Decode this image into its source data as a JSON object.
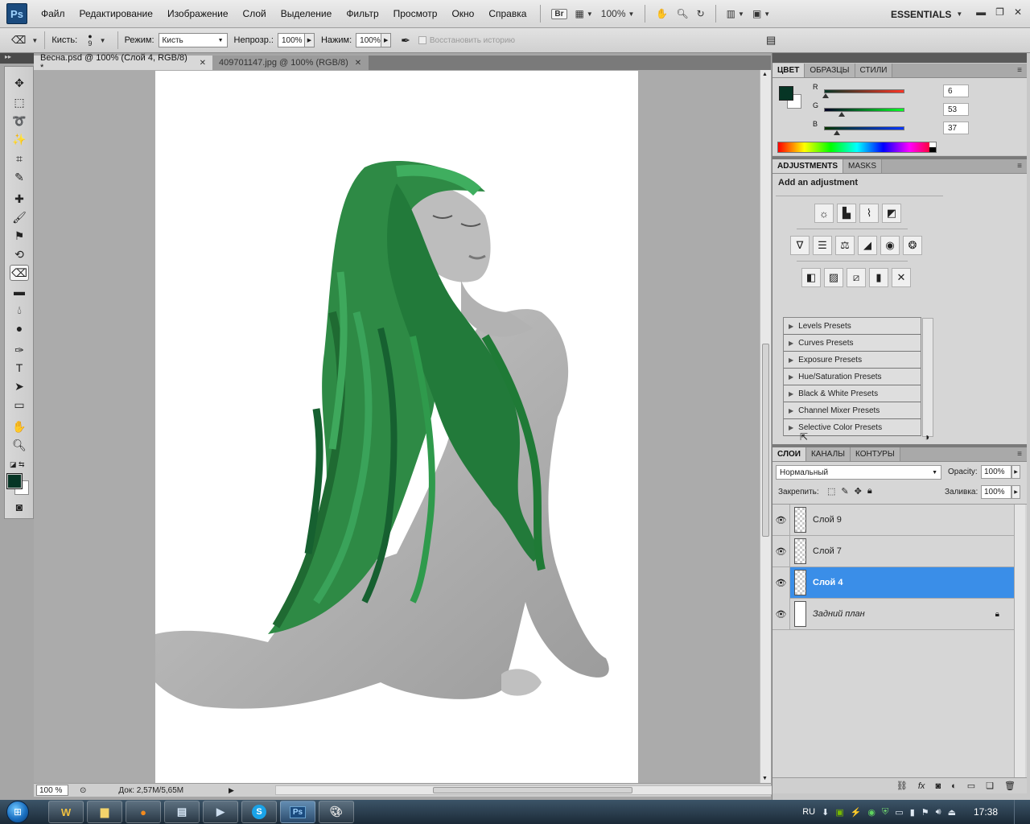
{
  "app": {
    "logo": "Ps",
    "menu": [
      "Файл",
      "Редактирование",
      "Изображение",
      "Слой",
      "Выделение",
      "Фильтр",
      "Просмотр",
      "Окно",
      "Справка"
    ],
    "bridge_label": "Br",
    "zoom": "100%",
    "workspace": "ESSENTIALS"
  },
  "options": {
    "brush_label": "Кисть:",
    "brush_size": "9",
    "mode_label": "Режим:",
    "mode_value": "Кисть",
    "opacity_label": "Непрозр.:",
    "opacity_value": "100%",
    "pressure_label": "Нажим:",
    "pressure_value": "100%",
    "history_label": "Восстановить историю"
  },
  "tabs": [
    {
      "label": "Весна.psd @ 100% (Слой 4, RGB/8) *"
    },
    {
      "label": "409701147.jpg @ 100% (RGB/8)"
    }
  ],
  "status": {
    "zoom": "100 %",
    "doc": "Док: 2,57M/5,65M"
  },
  "color_panel": {
    "tabs": [
      "ЦВЕТ",
      "ОБРАЗЦЫ",
      "СТИЛИ"
    ],
    "channels": [
      {
        "name": "R",
        "value": "6",
        "color": "#d02020"
      },
      {
        "name": "G",
        "value": "53",
        "color": "#20b030"
      },
      {
        "name": "B",
        "value": "37",
        "color": "#2040c0"
      }
    ],
    "foreground": "#063525"
  },
  "adjustments": {
    "tabs": [
      "ADJUSTMENTS",
      "MASKS"
    ],
    "heading": "Add an adjustment",
    "presets": [
      "Levels Presets",
      "Curves Presets",
      "Exposure Presets",
      "Hue/Saturation Presets",
      "Black & White Presets",
      "Channel Mixer Presets",
      "Selective Color Presets"
    ]
  },
  "layers": {
    "tabs": [
      "СЛОИ",
      "КАНАЛЫ",
      "КОНТУРЫ"
    ],
    "blend_mode": "Нормальный",
    "opacity_label": "Opacity:",
    "opacity_value": "100%",
    "lock_label": "Закрепить:",
    "fill_label": "Заливка:",
    "fill_value": "100%",
    "items": [
      {
        "name": "Слой 9"
      },
      {
        "name": "Слой 7"
      },
      {
        "name": "Слой 4"
      },
      {
        "name": "Задний план"
      }
    ]
  },
  "taskbar": {
    "lang": "RU",
    "time": "17:38",
    "ps_label": "Ps",
    "skype_label": "S"
  }
}
